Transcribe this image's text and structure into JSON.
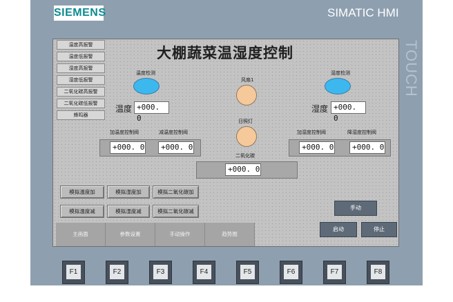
{
  "panel": {
    "brand": "SIEMENS",
    "product": "SIMATIC HMI",
    "side_label": "TOUCH"
  },
  "screen": {
    "title": "大棚蔬菜温湿度控制",
    "alarms": [
      "温度高报警",
      "温度低报警",
      "湿度高报警",
      "湿度低报警",
      "二氧化碳高报警",
      "二氧化碳低报警",
      "蜂鸣器"
    ],
    "temp_detect_label": "温度检测",
    "humidity_detect_label": "湿度检测",
    "fan_label": "风扇1",
    "sunlamp_label": "日照灯",
    "co2_label": "二氧化碳",
    "temp_label": "温度",
    "temp_value": "+000. 0",
    "humidity_label": "湿度",
    "humidity_value": "+000. 0",
    "heat_valve_label": "加温度控制阀",
    "cool_valve_label": "减温度控制阀",
    "heat_valve_value": "+000. 0",
    "cool_valve_value": "+000. 0",
    "humidify_valve_label": "加湿度控制阀",
    "dehumidify_valve_label": "降湿度控制阀",
    "humidify_valve_value": "+000. 0",
    "dehumidify_valve_value": "+000. 0",
    "co2_value": "+000. 0",
    "sim_buttons": {
      "temp_up": "模拟温度加",
      "humidity_up": "模拟湿度加",
      "co2_up": "模拟二氧化碳加",
      "temp_down": "模拟温度减",
      "humidity_down": "模拟湿度减",
      "co2_down": "模拟二氧化碳减"
    },
    "manual_button": "手动",
    "start_button": "启动",
    "stop_button": "停止",
    "nav": [
      "主画面",
      "参数设置",
      "手动操作",
      "趋势图"
    ]
  },
  "fkeys": [
    "F1",
    "F2",
    "F3",
    "F4",
    "F5",
    "F6",
    "F7",
    "F8"
  ],
  "colors": {
    "bezel": "#8e9fb0",
    "screen_bg": "#c3c3c3",
    "indicator_blue": "#3cb8ef",
    "indicator_orange": "#f6c99a",
    "brand_teal": "#0b8b92",
    "dark_button": "#5e6a78"
  }
}
